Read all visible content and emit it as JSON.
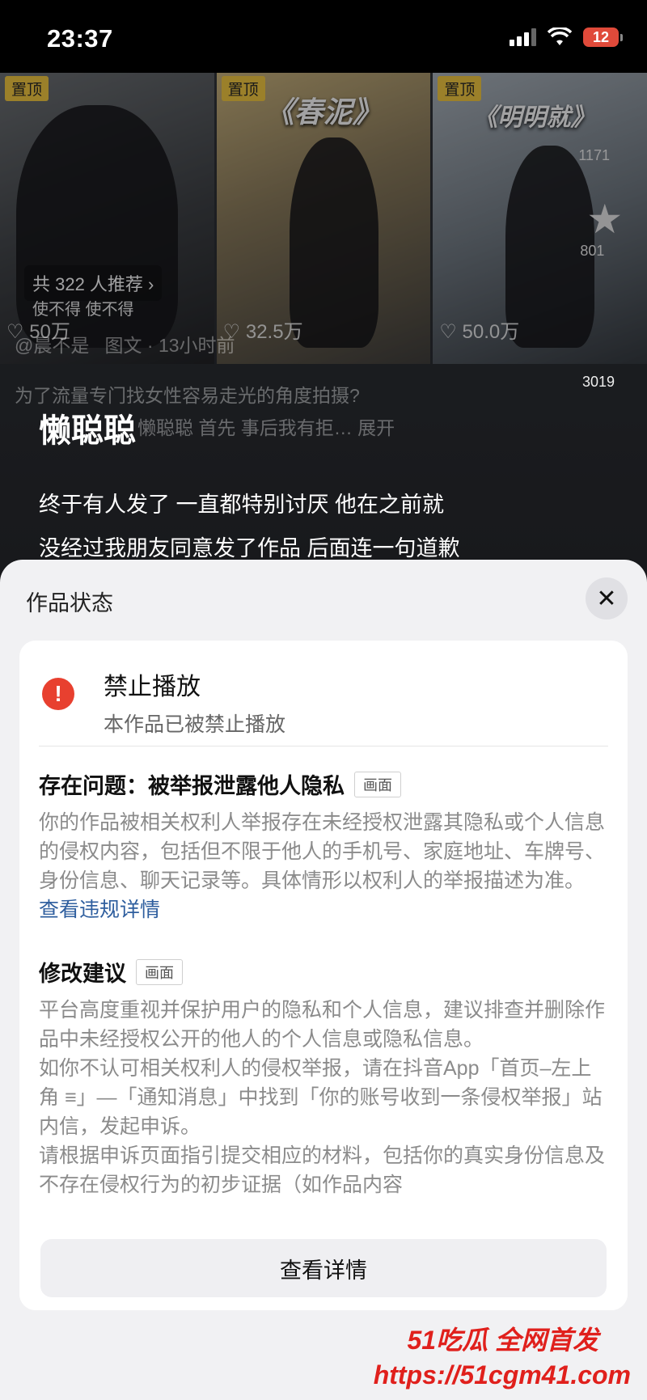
{
  "status_bar": {
    "time": "23:37",
    "battery": "12"
  },
  "background": {
    "videos": [
      {
        "pin": "置顶",
        "title": "",
        "likes": "50万"
      },
      {
        "pin": "置顶",
        "title": "《春泥》",
        "likes": "32.5万"
      },
      {
        "pin": "置顶",
        "title": "《明明就》",
        "likes": "50.0万"
      }
    ],
    "recommend": "共 322 人推荐 ›",
    "recommend_sub": "使不得 使不得",
    "side_stats": {
      "a": "1171",
      "b": "801",
      "c": "3019"
    },
    "ghost_author": "@晨不是",
    "ghost_meta": "图文 · 13小时前",
    "ghost_caption": "为了流量专门找女性容易走光的角度拍摄?",
    "ghost_caption2": "懒聪聪 首先 事后我有拒… 展开",
    "author": "懒聪聪",
    "desc_line1": "终于有人发了 一直都特别讨厌 他在之前就",
    "desc_line2": "没经过我朋友同意发了作品 后面连一句道歉"
  },
  "sheet": {
    "title": "作品状态",
    "status_title": "禁止播放",
    "status_sub": "本作品已被禁止播放",
    "issue_title": "存在问题：被举报泄露他人隐私",
    "issue_tag": "画面",
    "issue_body": "你的作品被相关权利人举报存在未经授权泄露其隐私或个人信息的侵权内容，包括但不限于他人的手机号、家庭地址、车牌号、身份信息、聊天记录等。具体情形以权利人的举报描述为准。",
    "issue_link": "查看违规详情",
    "advice_title": "修改建议",
    "advice_tag": "画面",
    "advice_p1": "平台高度重视并保护用户的隐私和个人信息，建议排查并删除作品中未经授权公开的他人的个人信息或隐私信息。",
    "advice_p2": "如你不认可相关权利人的侵权举报，请在抖音App「首页–左上角 ≡」—「通知消息」中找到「你的账号收到一条侵权举报」站内信，发起申诉。",
    "advice_p3": "请根据申诉页面指引提交相应的材料，包括你的真实身份信息及不存在侵权行为的初步证据（如作品内容",
    "button": "查看详情"
  },
  "watermark": {
    "logo": "51吃瓜 全网首发",
    "url": "https://51cgm41.com"
  },
  "colors": {
    "alert": "#e8402f",
    "link": "#2e5e9e",
    "pin": "#f4c93c"
  }
}
